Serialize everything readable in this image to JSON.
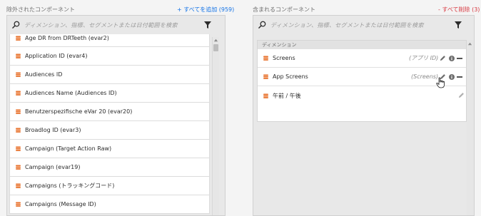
{
  "excluded": {
    "title": "除外されたコンポーネント",
    "add_all_label": "+ すべてを追加 (959)",
    "search_placeholder": "ディメンション、指標、セグメントまたは日付範囲を検索",
    "items": [
      "Age DR from DRTeeth (evar2)",
      "Application ID (evar4)",
      "Audiences ID",
      "Audiences Name (Audiences ID)",
      "Benutzerspezifische eVar 20 (evar20)",
      "Broadlog ID (evar3)",
      "Campaign (Target Action Raw)",
      "Campaign (evar19)",
      "Campaigns (トラッキングコード)",
      "Campaigns (Message ID)"
    ]
  },
  "included": {
    "title": "含まれるコンポーネント",
    "remove_all_label": "- すべて削除 (3)",
    "search_placeholder": "ディメンション、指標、セグメントまたは日付範囲を検索",
    "section_label": "ディメンション",
    "items": [
      {
        "label": "Screens",
        "meta": "(アプリ ID)"
      },
      {
        "label": "App Screens",
        "meta": "(Screens)"
      },
      {
        "label": "午前 / 午後",
        "meta": ""
      }
    ]
  },
  "colors": {
    "accent": "#1473e6",
    "remove": "#d7373f",
    "dimension_icon": "#e8702a"
  }
}
